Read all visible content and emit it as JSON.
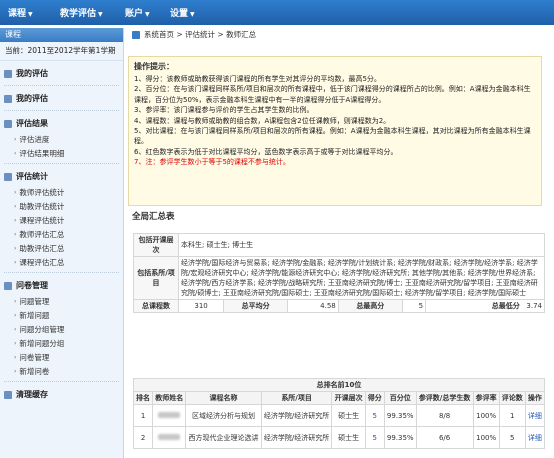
{
  "topnav": {
    "items": [
      {
        "label": "课程"
      },
      {
        "label": "教学评估"
      },
      {
        "label": "账户"
      },
      {
        "label": "设置"
      }
    ]
  },
  "sidebar": {
    "header": "课程",
    "term": "当前：2011至2012学年第1学期",
    "sections": [
      {
        "title": "我的评估",
        "items": []
      },
      {
        "title": "我的评估",
        "items": []
      },
      {
        "title": "评估结果",
        "items": [
          "评估进度",
          "评估结果明细"
        ]
      },
      {
        "title": "评估统计",
        "items": [
          "教师评估统计",
          "助教评估统计",
          "课程评估统计",
          "教师评估汇总",
          "助教评估汇总",
          "课程评估汇总"
        ]
      },
      {
        "title": "问卷管理",
        "items": [
          "问题管理",
          "新增问题",
          "问题分组管理",
          "新增问题分组",
          "问卷管理",
          "新增问卷"
        ]
      },
      {
        "title": "清理缓存",
        "items": []
      }
    ]
  },
  "breadcrumb": "系统首页 > 评估统计 > 教师汇总",
  "tips": {
    "title": "操作提示：",
    "lines": [
      "1、得分：该教师或助教获得该门课程的所有学生对其评分的平均数，最高5分。",
      "2、百分位：在与该门课程同样系所/项目和层次的所有课程中，低于该门课程得分的课程所占的比例。例如：A课程为金融本科生课程，百分位为50%，表示金融本科生课程中有一半的课程得分低于A课程得分。",
      "3、参评率：该门课程参与评价的学生占其学生数的比例。",
      "4、课程数：课程与教师或助教的组合数，A课程包含2位任课教师，则课程数为2。",
      "5、对比课程：在与该门课程同样系所/项目和层次的所有课程。例如：A课程为金融本科生课程，其对比课程为所有金融本科生课程。",
      "6、红色数字表示为低于对比课程平均分，蓝色数字表示高于或等于对比课程平均分。",
      "7、注：参评学生数小于等于5的课程不参与统计。"
    ]
  },
  "summary": {
    "title": "全局汇总表",
    "layer_label": "包括开课层次",
    "layer_value": "本科生; 硕士生; 博士生",
    "dept_label": "包括系所/项目",
    "dept_value": "经济学院/国际经济与贸易系; 经济学院/金融系; 经济学院/计划统计系; 经济学院/财政系; 经济学院/经济学系; 经济学院/宏观经济研究中心; 经济学院/能源经济研究中心; 经济学院/经济研究所; 其他学院/其他系; 经济学院/世界经济系; 经济学院/西方经济学系; 经济学院/战略研究所; 王亚南经济研究院/博士; 王亚南经济研究院/留学项目; 王亚南经济研究院/硕博士; 王亚南经济研究院/国际硕士; 王亚南经济研究院/国际硕士; 经济学院/留学项目; 经济学院/国际硕士",
    "course_count_label": "总课程数",
    "course_count": "310",
    "avg_label": "总平均分",
    "avg": "4.58",
    "max_label": "总最高分",
    "max": "5",
    "min_label": "总最低分",
    "min": "3.74"
  },
  "top10": {
    "caption": "总排名前10位",
    "headers": [
      "排名",
      "教师姓名",
      "课程名称",
      "系所/项目",
      "开课层次",
      "得分",
      "百分位",
      "参评数/总学生数",
      "参评率",
      "评论数",
      "操作"
    ],
    "rows": [
      {
        "rank": "1",
        "course": "区域经济分析与规划",
        "dept": "经济学院/经济研究所",
        "level": "硕士生",
        "score": "5",
        "pct": "99.35%",
        "ratio": "8/8",
        "rate": "100%",
        "comments": "1",
        "action": "详细"
      },
      {
        "rank": "2",
        "course": "西方现代企业理论选讲",
        "dept": "经济学院/经济研究所",
        "level": "硕士生",
        "score": "5",
        "pct": "99.35%",
        "ratio": "6/6",
        "rate": "100%",
        "comments": "5",
        "action": "详细"
      }
    ]
  },
  "colors": {
    "accent": "#1f5fa8",
    "tipbg": "#fffbe5",
    "warning": "#d00000",
    "link": "#1f56b6"
  }
}
